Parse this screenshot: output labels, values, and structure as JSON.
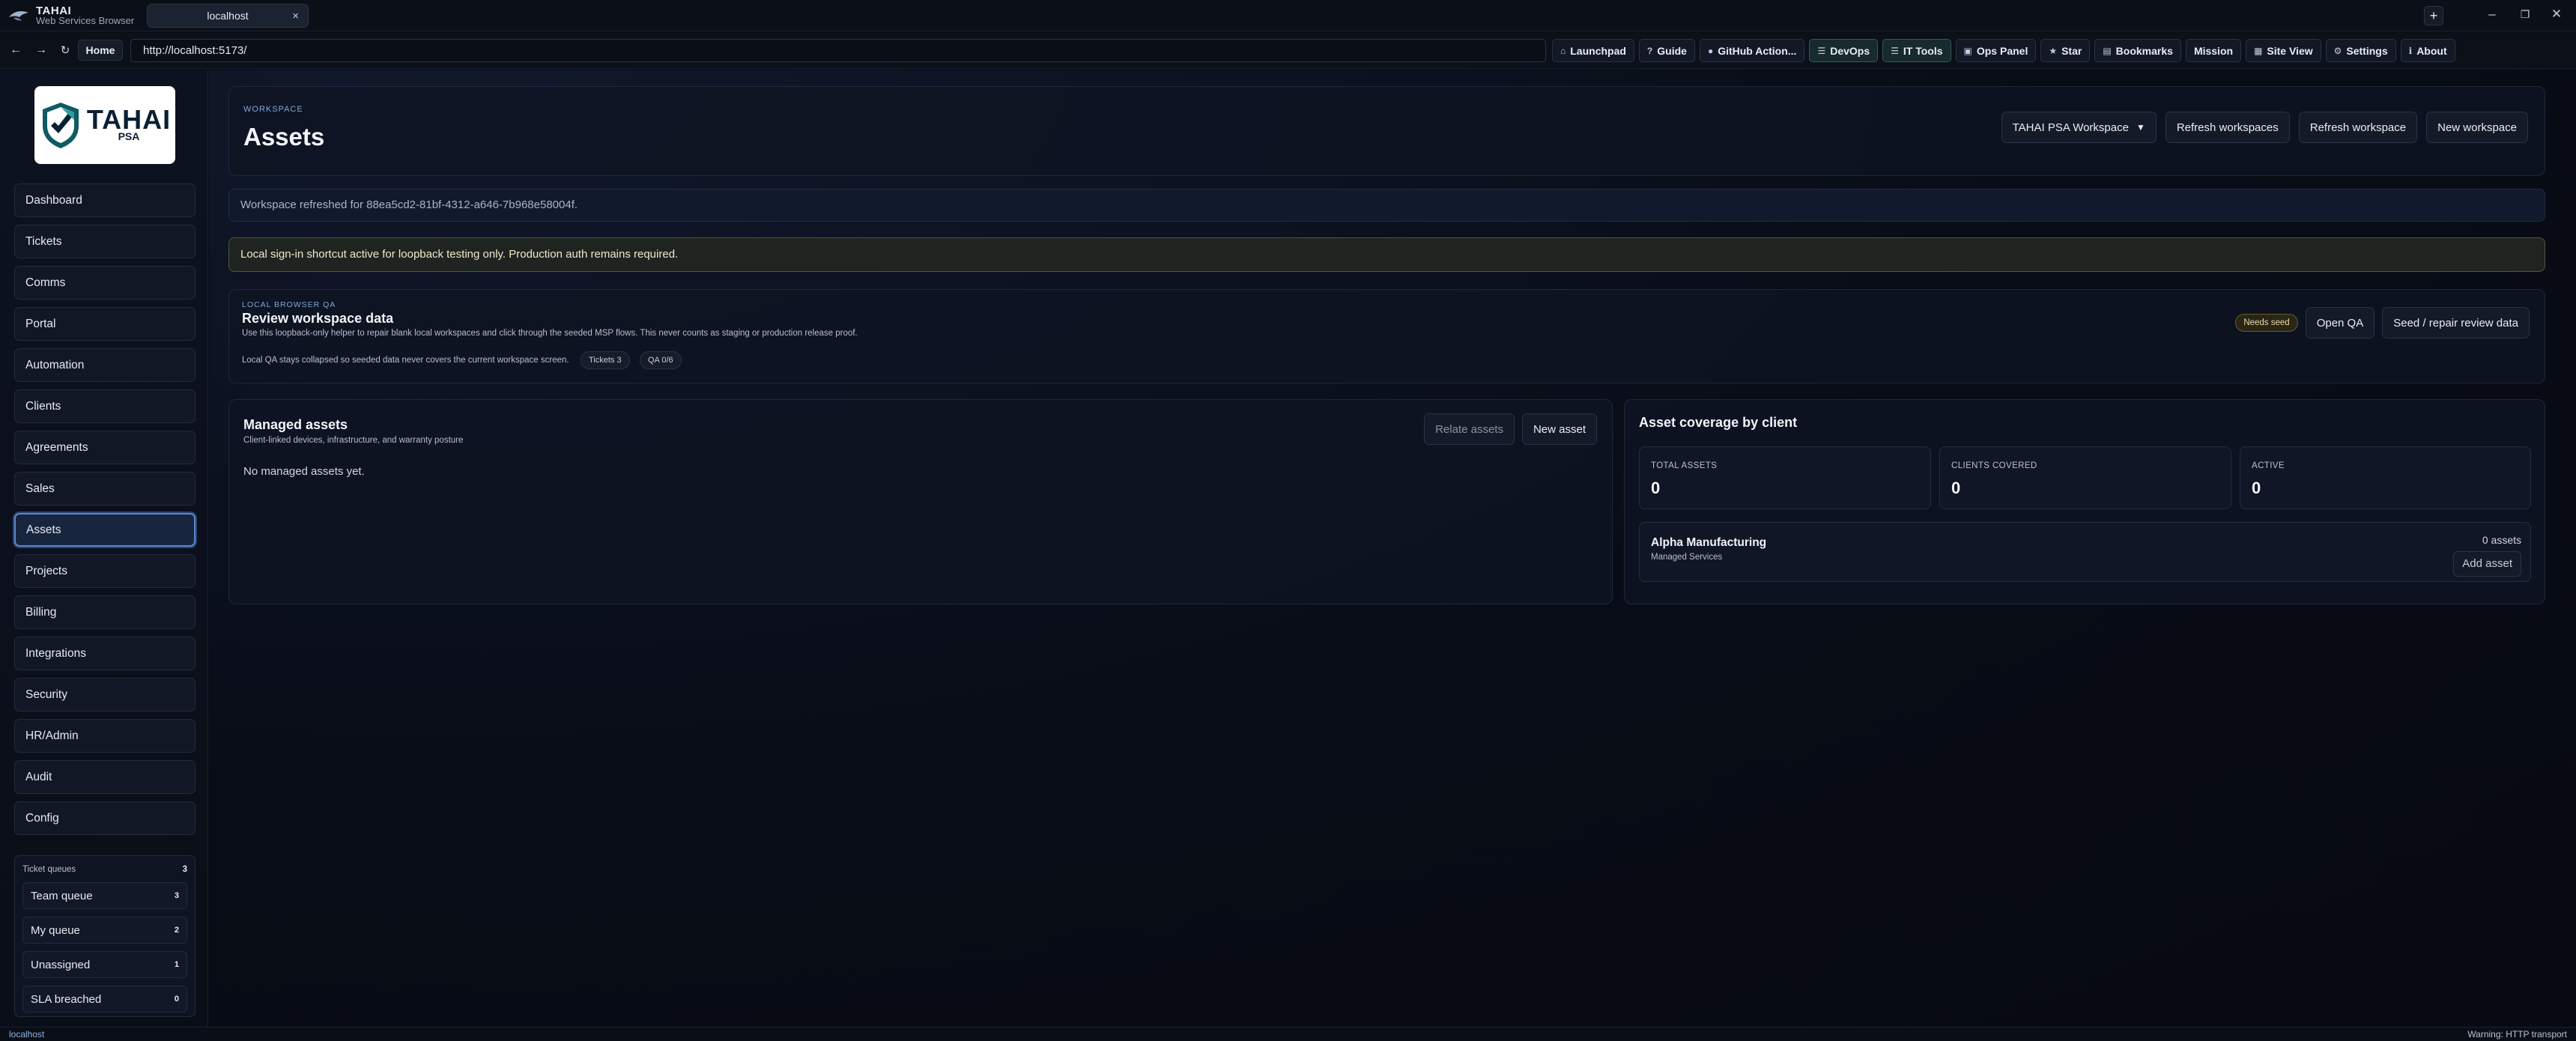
{
  "browser": {
    "brand_name": "TAHAI",
    "brand_sub": "Web Services Browser",
    "tab_title": "localhost",
    "new_tab": "+",
    "url": "http://localhost:5173/",
    "home_label": "Home",
    "toolbar": [
      {
        "icon": "rocket-icon",
        "glyph": "⌂",
        "label": "Launchpad"
      },
      {
        "icon": "question-icon",
        "glyph": "?",
        "label": "Guide"
      },
      {
        "icon": "github-icon",
        "glyph": "●",
        "label": "GitHub Action..."
      },
      {
        "icon": "menu-icon",
        "glyph": "☰",
        "label": "DevOps",
        "accent": true
      },
      {
        "icon": "menu-icon",
        "glyph": "☰",
        "label": "IT Tools",
        "accent": true
      },
      {
        "icon": "panel-icon",
        "glyph": "▣",
        "label": "Ops Panel"
      },
      {
        "icon": "star-icon",
        "glyph": "★",
        "label": "Star"
      },
      {
        "icon": "bookmark-icon",
        "glyph": "▤",
        "label": "Bookmarks"
      },
      {
        "icon": "",
        "glyph": "",
        "label": "Mission"
      },
      {
        "icon": "sitemap-icon",
        "glyph": "▦",
        "label": "Site View"
      },
      {
        "icon": "gear-icon",
        "glyph": "⚙",
        "label": "Settings"
      },
      {
        "icon": "info-icon",
        "glyph": "ℹ",
        "label": "About"
      }
    ]
  },
  "sidebar": {
    "logo_word": "TAHAI",
    "logo_sub": "PSA",
    "items": [
      {
        "label": "Dashboard"
      },
      {
        "label": "Tickets"
      },
      {
        "label": "Comms"
      },
      {
        "label": "Portal"
      },
      {
        "label": "Automation"
      },
      {
        "label": "Clients"
      },
      {
        "label": "Agreements"
      },
      {
        "label": "Sales"
      },
      {
        "label": "Assets",
        "active": true
      },
      {
        "label": "Projects"
      },
      {
        "label": "Billing"
      },
      {
        "label": "Integrations"
      },
      {
        "label": "Security"
      },
      {
        "label": "HR/Admin"
      },
      {
        "label": "Audit"
      },
      {
        "label": "Config"
      }
    ],
    "queues": {
      "title": "Ticket queues",
      "total": "3",
      "items": [
        {
          "label": "Team queue",
          "count": "3"
        },
        {
          "label": "My queue",
          "count": "2"
        },
        {
          "label": "Unassigned",
          "count": "1"
        },
        {
          "label": "SLA breached",
          "count": "0"
        }
      ]
    }
  },
  "header": {
    "eyebrow": "WORKSPACE",
    "title": "Assets",
    "workspace_select": "TAHAI PSA Workspace",
    "refresh_workspaces": "Refresh workspaces",
    "refresh_workspace": "Refresh workspace",
    "new_workspace": "New workspace"
  },
  "notice": "Workspace refreshed for 88ea5cd2-81bf-4312-a646-7b968e58004f.",
  "warning": "Local sign-in shortcut active for loopback testing only. Production auth remains required.",
  "qa": {
    "eyebrow": "LOCAL BROWSER QA",
    "title": "Review workspace data",
    "description": "Use this loopback-only helper to repair blank local workspaces and click through the seeded MSP flows. This never counts as staging or production release proof.",
    "note": "Local QA stays collapsed so seeded data never covers the current workspace screen.",
    "pill_tickets": "Tickets 3",
    "pill_qa": "QA 0/6",
    "badge": "Needs seed",
    "open_qa": "Open QA",
    "seed_repair": "Seed / repair review data"
  },
  "managed": {
    "title": "Managed assets",
    "subtitle": "Client-linked devices, infrastructure, and warranty posture",
    "relate_assets": "Relate assets",
    "new_asset": "New asset",
    "empty": "No managed assets yet."
  },
  "coverage": {
    "title": "Asset coverage by client",
    "stats": [
      {
        "label": "TOTAL ASSETS",
        "value": "0"
      },
      {
        "label": "CLIENTS COVERED",
        "value": "0"
      },
      {
        "label": "ACTIVE",
        "value": "0"
      }
    ],
    "client": {
      "name": "Alpha Manufacturing",
      "plan": "Managed Services",
      "count": "0 assets",
      "add": "Add asset"
    }
  },
  "status": {
    "left": "localhost",
    "right": "Warning: HTTP transport"
  }
}
